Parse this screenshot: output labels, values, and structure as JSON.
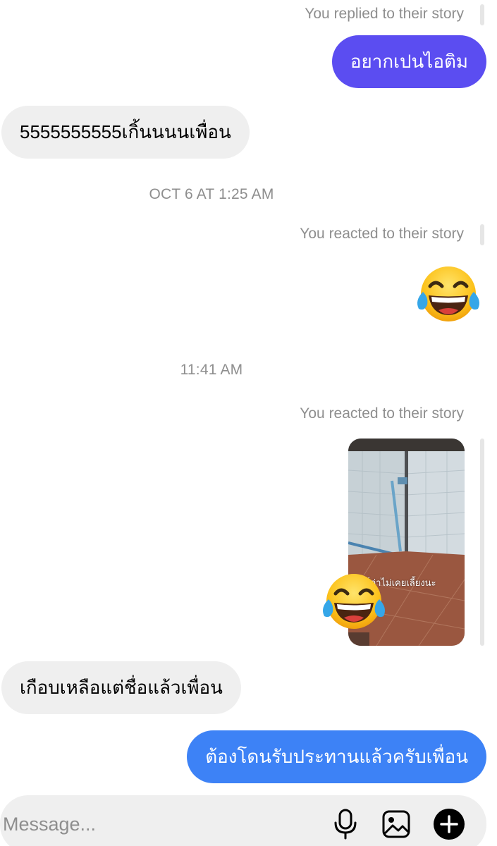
{
  "thread": {
    "replied_context": "You replied to their story",
    "reply_message": "อยากเปนไอติม",
    "reply_color": "#5b4df1",
    "incoming_1": "5555555555เกิ้นนนนเพื่อน",
    "timestamp_1": "OCT 6 AT 1:25 AM",
    "reacted_context_1": "You reacted to their story",
    "reaction_emoji_1": "face-with-tears-of-joy",
    "timestamp_2": "11:41 AM",
    "reacted_context_2": "You reacted to their story",
    "story_caption": "ก็ว่าไม่เคยเลี้ยงนะ",
    "reaction_emoji_2": "face-with-tears-of-joy",
    "incoming_2": "เกือบเหลือแต่ชื่อแล้วเพื่อน",
    "outgoing_last": "ต้องโดนรับประทานแล้วครับเพื่อน",
    "outgoing_last_color": "#3d82f6"
  },
  "composer": {
    "placeholder": "Message...",
    "icons": [
      "microphone-icon",
      "image-icon",
      "add-icon"
    ]
  }
}
